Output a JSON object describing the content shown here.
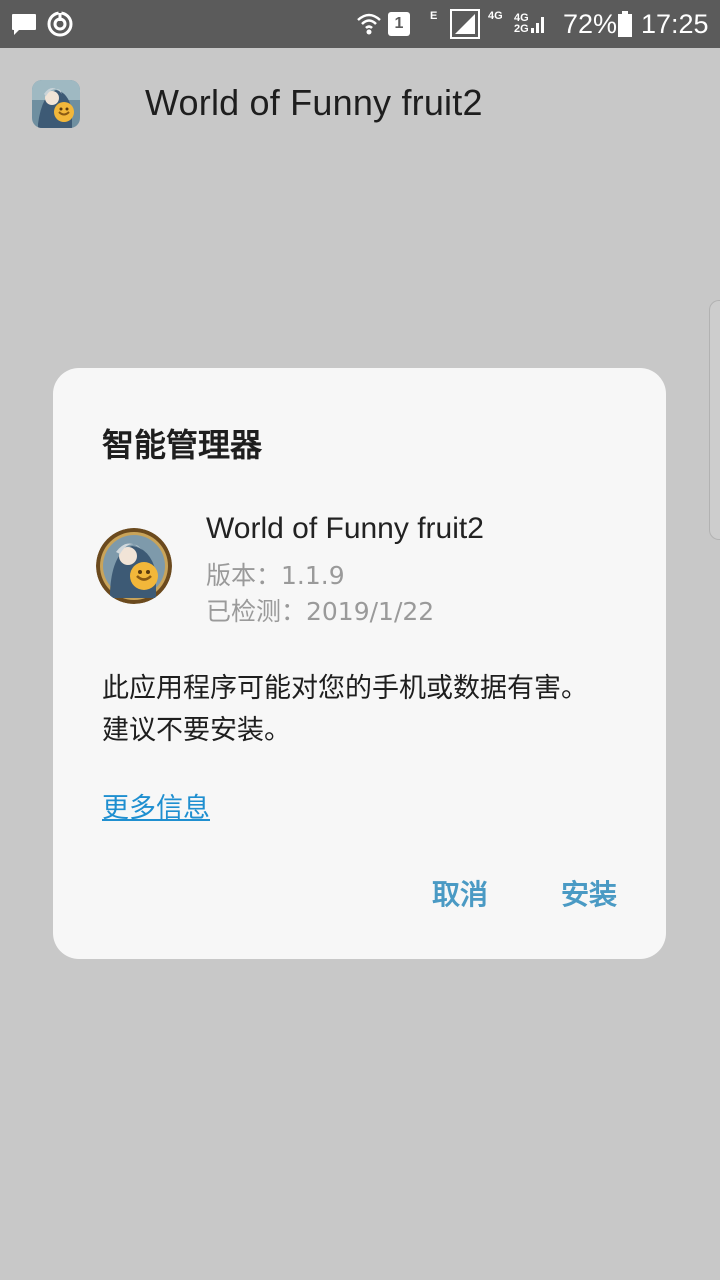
{
  "status_bar": {
    "network_type_e": "E",
    "sim1_label": "4G",
    "sim2_label_top": "4G",
    "sim2_label_bottom": "2G",
    "battery_percent": "72%",
    "time": "17:25",
    "sim_slot": "1",
    "icons": [
      "message-icon",
      "sync-icon",
      "wifi-icon",
      "sim1-badge-icon",
      "signal-icon",
      "battery-icon"
    ]
  },
  "header": {
    "app_title": "World of Funny fruit2",
    "icon": "app-icon"
  },
  "dialog": {
    "title": "智能管理器",
    "app_name": "World of Funny fruit2",
    "version": "版本：1.1.9",
    "scanned": "已检测：2019/1/22",
    "warning_line1": "此应用程序可能对您的手机或数据有害。",
    "warning_line2": "建议不要安装。",
    "more_info": "更多信息",
    "cancel_label": "取消",
    "install_label": "安装"
  },
  "colors": {
    "background": "#c8c8c8",
    "status_bar": "#5b5b5b",
    "dialog": "#f7f7f7",
    "accent_button": "#4a9ac4",
    "link": "#1f8fd0"
  }
}
